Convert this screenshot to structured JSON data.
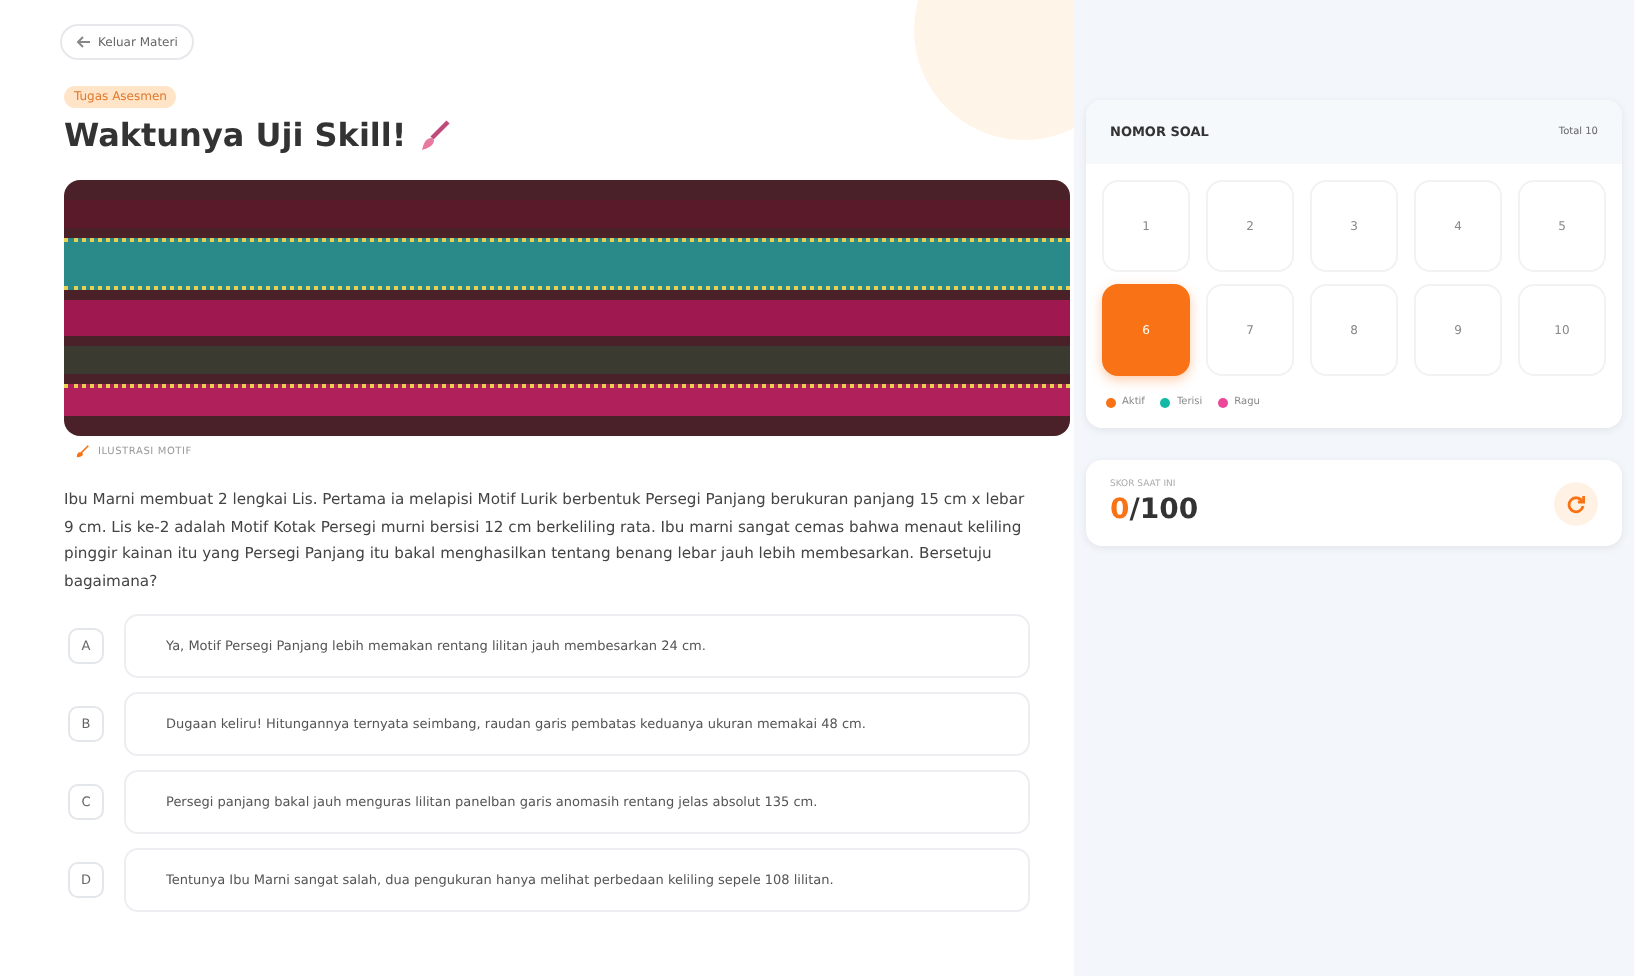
{
  "back_button": {
    "label": "Keluar Materi"
  },
  "badge": "Tugas Asesmen",
  "title": "Waktunya Uji Skill!",
  "image_caption": "ILUSTRASI MOTIF",
  "question": "Ibu Marni membuat 2 lengkai Lis. Pertama ia melapisi Motif Lurik berbentuk Persegi Panjang berukuran panjang 15 cm x lebar 9 cm. Lis ke-2 adalah Motif Kotak Persegi murni bersisi 12 cm berkeliling rata. Ibu marni sangat cemas bahwa menaut keliling pinggir kainan itu yang Persegi Panjang itu bakal menghasilkan tentang benang lebar jauh lebih membesarkan. Bersetuju bagaimana?",
  "options": [
    {
      "letter": "A",
      "text": "Ya, Motif Persegi Panjang lebih memakan rentang lilitan jauh membesarkan 24 cm."
    },
    {
      "letter": "B",
      "text": "Dugaan keliru! Hitungannya ternyata seimbang, raudan garis pembatas keduanya ukuran memakai 48 cm."
    },
    {
      "letter": "C",
      "text": "Persegi panjang bakal jauh menguras lilitan panelban garis anomasih rentang jelas absolut 135 cm."
    },
    {
      "letter": "D",
      "text": "Tentunya Ibu Marni sangat salah, dua pengukuran hanya melihat perbedaan keliling sepele 108 lilitan."
    }
  ],
  "sidebar": {
    "title": "NOMOR SOAL",
    "count": "Total 10",
    "numbers": [
      {
        "label": "1",
        "selected": false
      },
      {
        "label": "2",
        "selected": false
      },
      {
        "label": "3",
        "selected": false
      },
      {
        "label": "4",
        "selected": false
      },
      {
        "label": "5",
        "selected": false
      },
      {
        "label": "6",
        "selected": true
      },
      {
        "label": "7",
        "selected": false
      },
      {
        "label": "8",
        "selected": false
      },
      {
        "label": "9",
        "selected": false
      },
      {
        "label": "10",
        "selected": false
      }
    ],
    "legend": [
      {
        "label": "Aktif",
        "color": "#f97316"
      },
      {
        "label": "Terisi",
        "color": "#14b8a6"
      },
      {
        "label": "Ragu",
        "color": "#ec4899"
      }
    ]
  },
  "score": {
    "label": "SKOR SAAT INI",
    "value": "0",
    "total": "/100"
  }
}
